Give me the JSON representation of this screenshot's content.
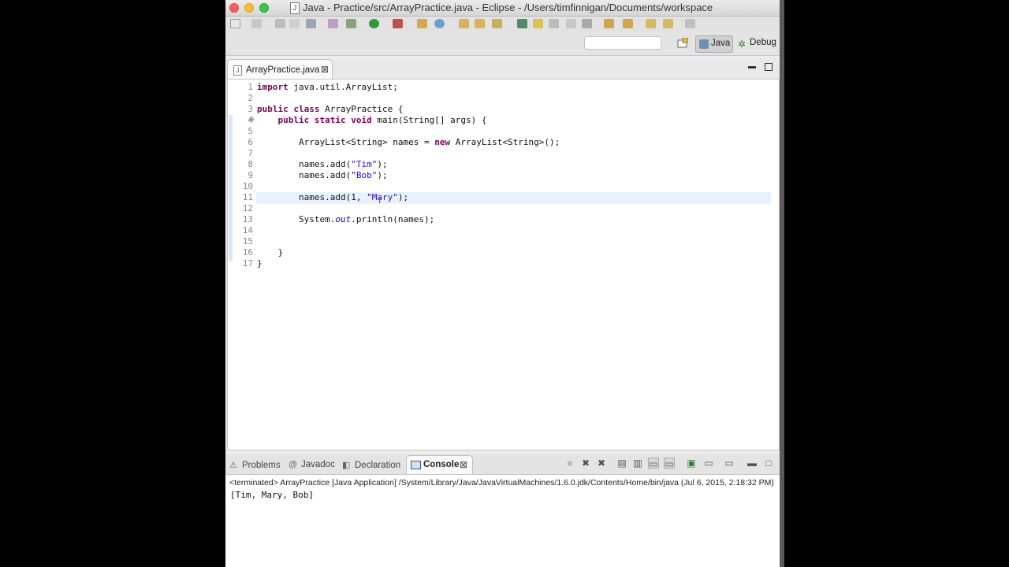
{
  "window": {
    "title": "Java - Practice/src/ArrayPractice.java - Eclipse - /Users/timfinnigan/Documents/workspace",
    "title_icon": "J"
  },
  "perspectives": [
    {
      "label": "Java",
      "active": true
    },
    {
      "label": "Debug",
      "active": false
    }
  ],
  "quick_access": {
    "value": ""
  },
  "editor": {
    "tab_label": "ArrayPractice.java",
    "line_numbers": [
      "1",
      "2",
      "3",
      "4",
      "5",
      "6",
      "7",
      "8",
      "9",
      "10",
      "11",
      "12",
      "13",
      "14",
      "15",
      "16",
      "17"
    ],
    "lines": [
      "import java.util.ArrayList;",
      "",
      "public class ArrayPractice {",
      "    public static void main(String[] args) {",
      "",
      "        ArrayList<String> names = new ArrayList<String>();",
      "",
      "        names.add(\"Tim\");",
      "        names.add(\"Bob\");",
      "",
      "        names.add(1, \"Mary\");",
      "",
      "        System.out.println(names);",
      "",
      "",
      "    }",
      "}"
    ],
    "current_line": 11
  },
  "console": {
    "tabs": [
      "Problems",
      "Javadoc",
      "Declaration",
      "Console"
    ],
    "active_tab": "Console",
    "terminated_text": "<terminated> ArrayPractice [Java Application] /System/Library/Java/JavaVirtualMachines/1.6.0.jdk/Contents/Home/bin/java (Jul 6, 2015, 2:18:32 PM)",
    "output": "[Tim, Mary, Bob]"
  },
  "colors": {
    "keyword": "#7f0055",
    "string": "#2a00ff",
    "field": "#0000c0",
    "current_line": "#e8f2fe"
  }
}
